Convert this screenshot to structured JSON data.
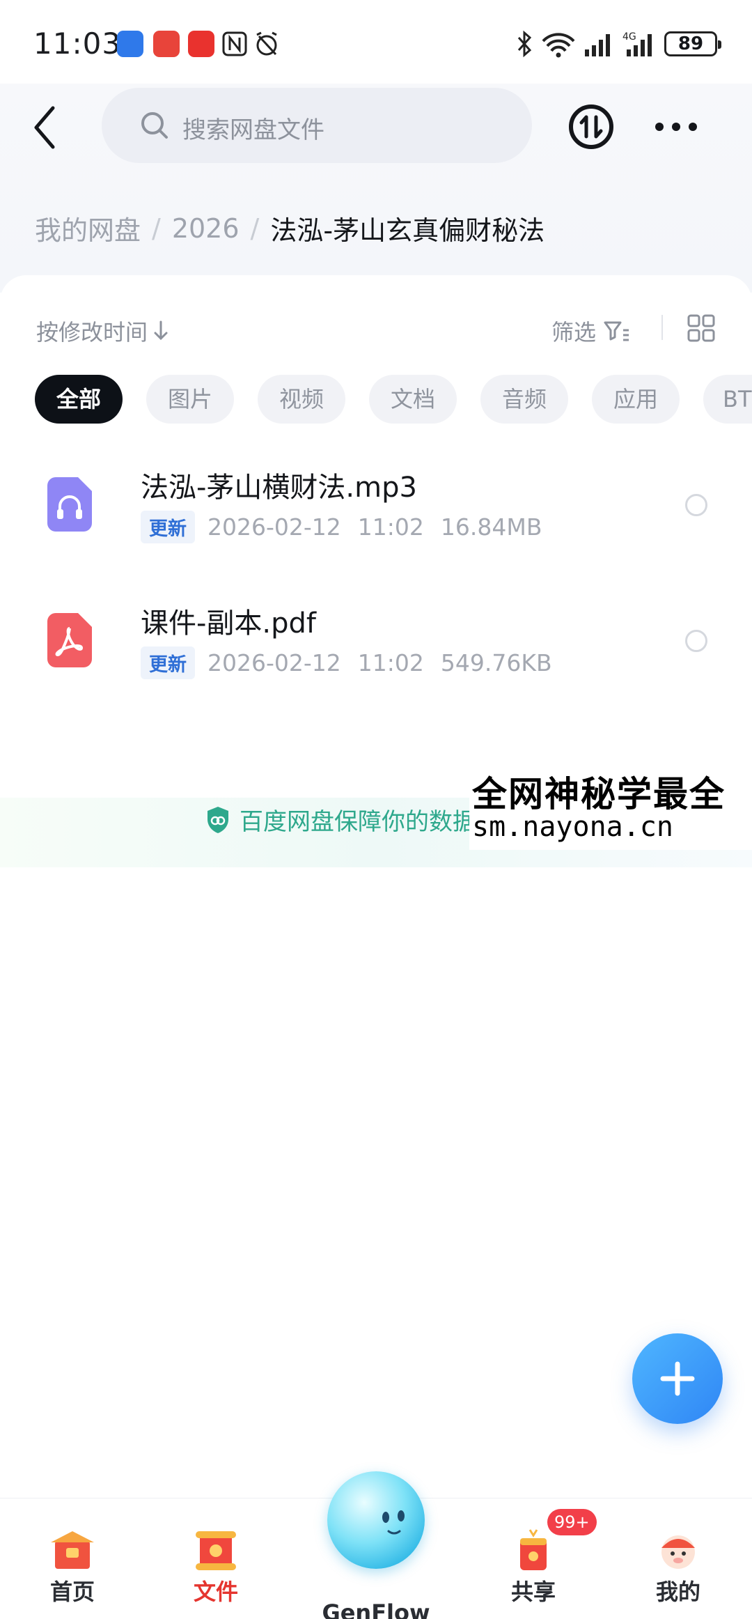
{
  "status_bar": {
    "time": "11:03",
    "battery": "89"
  },
  "header": {
    "search_placeholder": "搜索网盘文件"
  },
  "breadcrumb": {
    "root": "我的网盘",
    "level1": "2026",
    "current": "法泓-茅山玄真偏财秘法"
  },
  "toolbar": {
    "sort_label": "按修改时间",
    "filter_label": "筛选"
  },
  "chips": [
    "全部",
    "图片",
    "视频",
    "文档",
    "音频",
    "应用",
    "BT"
  ],
  "files": [
    {
      "name": "法泓-茅山横财法.mp3",
      "badge": "更新",
      "date": "2026-02-12",
      "time": "11:02",
      "size": "16.84MB",
      "type": "audio"
    },
    {
      "name": "课件-副本.pdf",
      "badge": "更新",
      "date": "2026-02-12",
      "time": "11:02",
      "size": "549.76KB",
      "type": "pdf"
    }
  ],
  "protect_text": "百度网盘保障你的数据",
  "watermark": {
    "line1": "全网神秘学最全",
    "line2": "sm.nayona.cn"
  },
  "tabs": {
    "home": "首页",
    "files": "文件",
    "genflow": "GenFlow",
    "share": "共享",
    "mine": "我的",
    "share_badge": "99+"
  },
  "colors": {
    "accent_red": "#e5352f",
    "fab_blue": "#2f86f5",
    "protect_green": "#2ea88c",
    "audio_purple": "#8f86f5",
    "pdf_red": "#f25d63"
  }
}
